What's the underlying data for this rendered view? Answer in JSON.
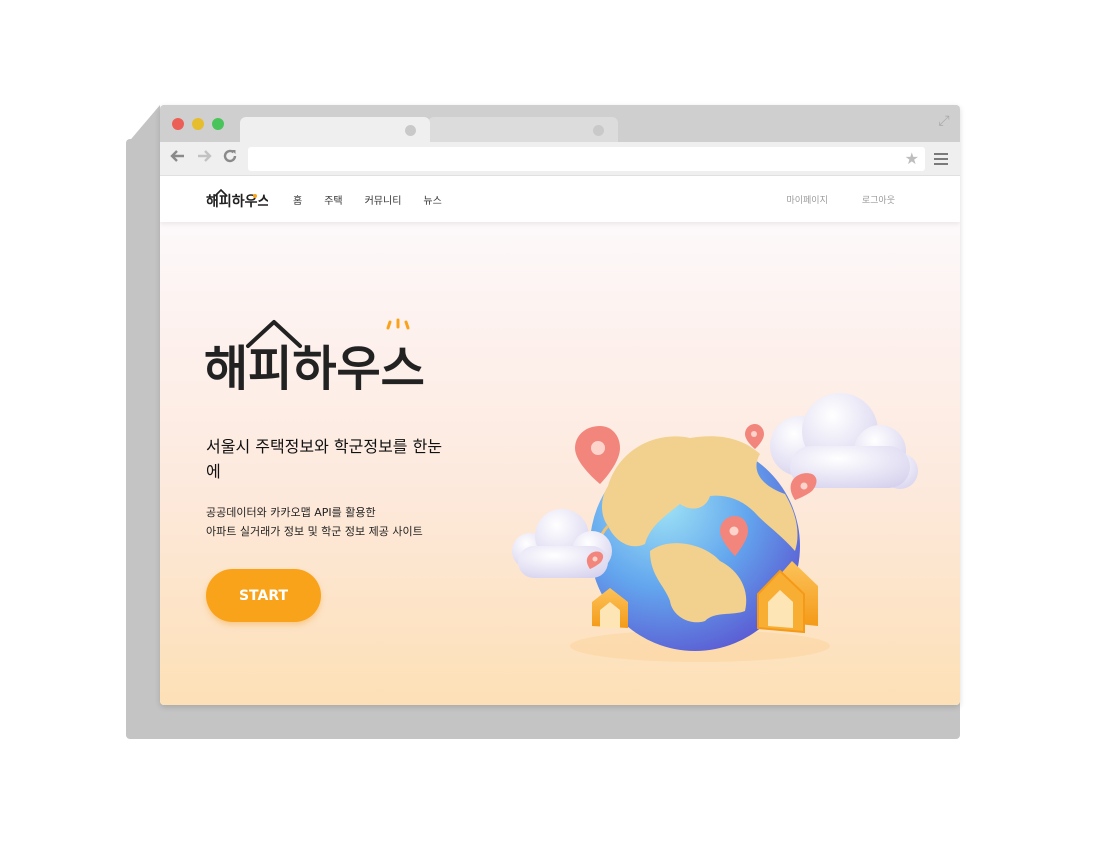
{
  "browser": {
    "url": "",
    "icons": {
      "back": "arrow-left-icon",
      "forward": "arrow-right-icon",
      "reload": "reload-icon",
      "bookmark": "star-icon",
      "menu": "hamburger-menu-icon",
      "expand": "expand-icon"
    }
  },
  "site": {
    "logo_text": "해피하우스",
    "nav": {
      "links": [
        "홈",
        "주택",
        "커뮤니티",
        "뉴스"
      ],
      "right": [
        "마이페이지",
        "로그아웃"
      ]
    },
    "hero": {
      "logo_text": "해피하우스",
      "headline_line1": "서울시 주택정보와 학군정보를 한눈",
      "headline_line2": "에",
      "desc_line1": "공공데이터와 카카오맵 API를 활용한",
      "desc_line2": "아파트 실거래가 정보 및 학군 정보 제공 사이트",
      "start_label": "START"
    },
    "colors": {
      "accent": "#f9a31a",
      "pin": "#f2867c",
      "globe_ocean": "#5d8ee8",
      "globe_land": "#f1d18d"
    }
  }
}
